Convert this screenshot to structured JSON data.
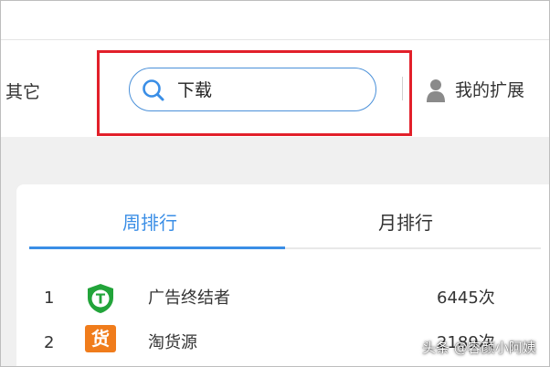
{
  "nav": {
    "other_label": "其它",
    "my_extensions_label": "我的扩展"
  },
  "search": {
    "value": "下载"
  },
  "ranking": {
    "tabs": [
      {
        "label": "周排行",
        "active": true
      },
      {
        "label": "月排行",
        "active": false
      }
    ],
    "items": [
      {
        "rank": "1",
        "name": "广告终结者",
        "count": "6445次",
        "icon": "green-shield-t-icon",
        "icon_text": "T"
      },
      {
        "rank": "2",
        "name": "淘货源",
        "count": "2189次",
        "icon": "orange-huo-badge-icon",
        "icon_text": "货"
      }
    ]
  },
  "watermark": "头条 @容颜小阿姨",
  "colors": {
    "accent": "#3a8ee6",
    "highlight": "#e2202a",
    "shield_green": "#22a43a",
    "badge_orange": "#f07c1b"
  }
}
